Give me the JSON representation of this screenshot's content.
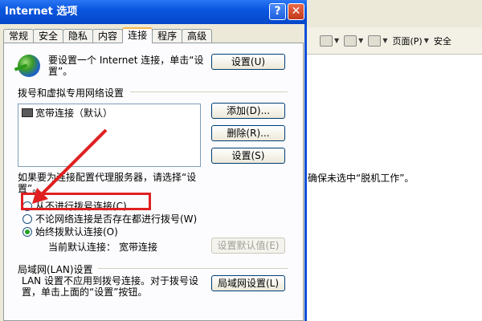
{
  "dialog": {
    "title": "Internet 选项",
    "help_glyph": "?",
    "close_glyph": "✕",
    "tabs": [
      "常规",
      "安全",
      "隐私",
      "内容",
      "连接",
      "程序",
      "高级"
    ],
    "active_tab": "连接"
  },
  "setup": {
    "text": "要设置一个 Internet 连接，单击“设置”。",
    "button": "设置(U)"
  },
  "dialup": {
    "group_label": "拨号和虚拟专用网络设置",
    "items": [
      "宽带连接（默认）"
    ],
    "add_button": "添加(D)...",
    "delete_button": "删除(R)...",
    "settings_button": "设置(S)"
  },
  "proxy": {
    "text": "如果要为连接配置代理服务器，请选择“设置”。"
  },
  "options": [
    {
      "label": "从不进行拨号连接(C)",
      "checked": false
    },
    {
      "label": "不论网络连接是否存在都进行拨号(W)",
      "checked": false
    },
    {
      "label": "始终拨默认连接(O)",
      "checked": true
    }
  ],
  "current_default": {
    "label": "当前默认连接：",
    "value": "宽带连接",
    "set_default_button": "设置默认值(E)"
  },
  "lan": {
    "group_label": "局域网(LAN)设置",
    "text": "LAN 设置不应用到拨号连接。对于拨号设置，单击上面的“设置”按钮。",
    "button": "局域网设置(L)"
  },
  "browser": {
    "toolbar": {
      "page": "页面(P)",
      "safety": "安全"
    },
    "content_text": "确保未选中“脱机工作”。"
  },
  "colors": {
    "highlight": "#e02020",
    "titlebar": "#0a56e0"
  }
}
